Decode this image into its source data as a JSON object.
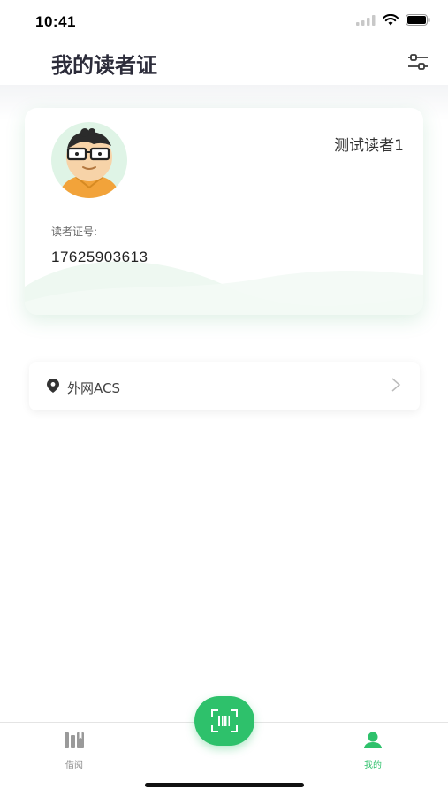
{
  "status_bar": {
    "time": "10:41"
  },
  "header": {
    "title": "我的读者证"
  },
  "card": {
    "reader_name": "测试读者1",
    "number_label": "读者证号:",
    "number": "17625903613"
  },
  "location": {
    "name": "外网ACS"
  },
  "tabs": [
    {
      "label": "借阅",
      "icon": "books-icon",
      "active": false
    },
    {
      "label": "我的",
      "icon": "person-icon",
      "active": true
    }
  ],
  "scan_button": {
    "icon": "barcode-scan-icon"
  },
  "colors": {
    "accent": "#2ec16b",
    "title": "#2c2c3a"
  }
}
